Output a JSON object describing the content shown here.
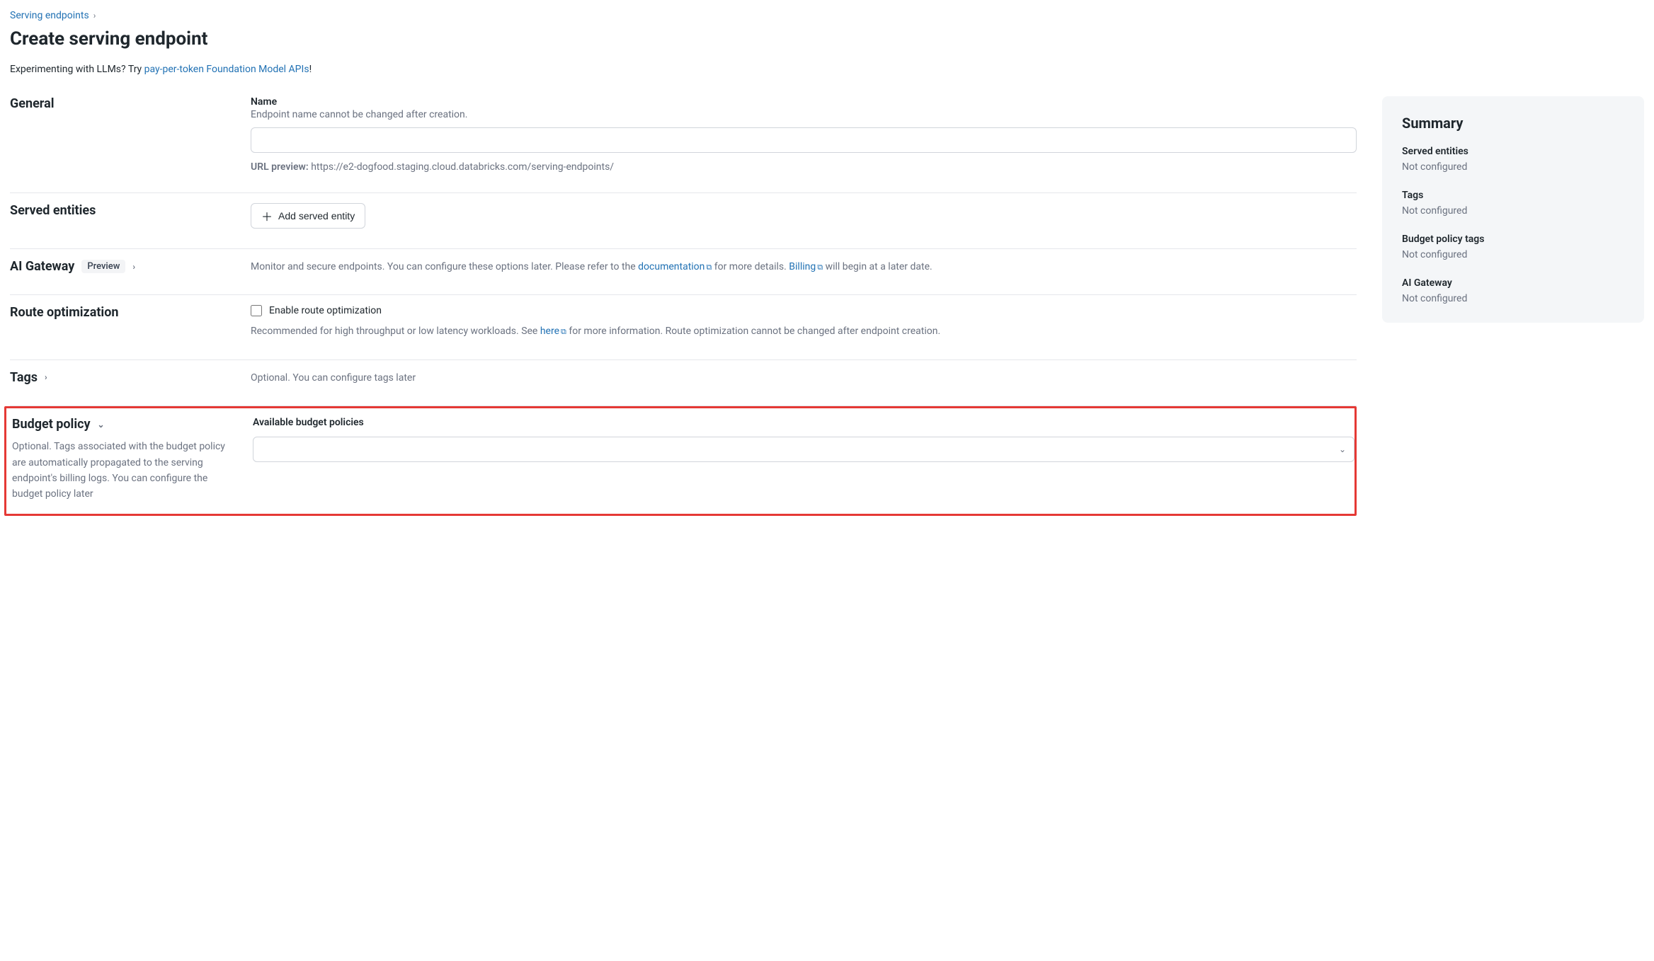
{
  "breadcrumb": {
    "parent": "Serving endpoints"
  },
  "page_title": "Create serving endpoint",
  "subtitle": {
    "text_before": "Experimenting with LLMs? Try ",
    "link": "pay-per-token Foundation Model APIs",
    "text_after": "!"
  },
  "general": {
    "heading": "General",
    "name_label": "Name",
    "name_hint": "Endpoint name cannot be changed after creation.",
    "name_value": "",
    "url_preview_label": "URL preview:",
    "url_preview_value": "https://e2-dogfood.staging.cloud.databricks.com/serving-endpoints/"
  },
  "served_entities": {
    "heading": "Served entities",
    "add_button": "Add served entity"
  },
  "ai_gateway": {
    "heading": "AI Gateway",
    "badge": "Preview",
    "text1": "Monitor and secure endpoints. You can configure these options later. Please refer to the ",
    "doc_link": "documentation",
    "text2": " for more details. ",
    "billing_link": "Billing",
    "text3": " will begin at a later date."
  },
  "route_opt": {
    "heading": "Route optimization",
    "checkbox_label": "Enable route optimization",
    "text1": "Recommended for high throughput or low latency workloads. See ",
    "here_link": "here",
    "text2": " for more information. Route optimization cannot be changed after endpoint creation."
  },
  "tags": {
    "heading": "Tags",
    "body": "Optional. You can configure tags later"
  },
  "budget_policy": {
    "heading": "Budget policy",
    "desc": "Optional. Tags associated with the budget policy are automatically propagated to the serving endpoint's billing logs. You can configure the budget policy later",
    "field_label": "Available budget policies",
    "selected": ""
  },
  "summary": {
    "heading": "Summary",
    "items": [
      {
        "label": "Served entities",
        "value": "Not configured"
      },
      {
        "label": "Tags",
        "value": "Not configured"
      },
      {
        "label": "Budget policy tags",
        "value": "Not configured"
      },
      {
        "label": "AI Gateway",
        "value": "Not configured"
      }
    ]
  }
}
